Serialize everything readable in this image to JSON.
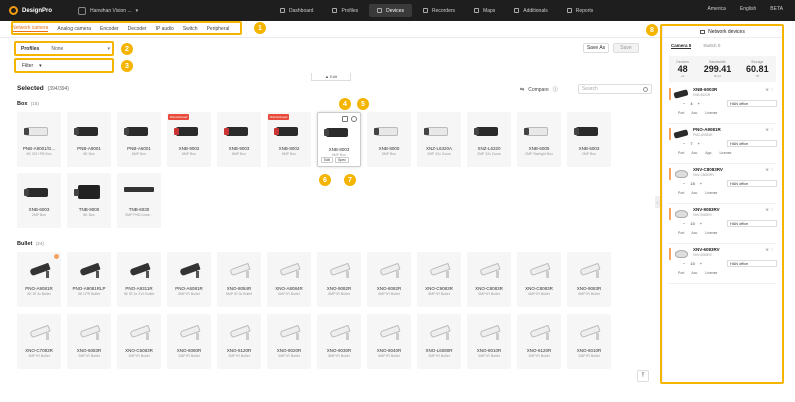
{
  "app": {
    "name": "DesignPro",
    "project": "Hanwhan Vision ..."
  },
  "nav": [
    {
      "label": "Dashboard",
      "active": false
    },
    {
      "label": "Profiles",
      "active": false
    },
    {
      "label": "Devices",
      "active": true
    },
    {
      "label": "Recorders",
      "active": false
    },
    {
      "label": "Maps",
      "active": false
    },
    {
      "label": "Additionals",
      "active": false
    },
    {
      "label": "Reports",
      "active": false
    }
  ],
  "top_right": {
    "region": "America",
    "language": "English",
    "user": "BETA"
  },
  "subtabs": [
    "Network camera",
    "Analog camera",
    "Encoder",
    "Decoder",
    "IP audio",
    "Switch",
    "Peripheral"
  ],
  "profile": {
    "label": "Profiles",
    "value": "None"
  },
  "buttons": {
    "save_as": "Save As",
    "save": "Save"
  },
  "filter": {
    "label": "Filter"
  },
  "edit_tab": "▲ Edit",
  "selected": {
    "label": "Selected",
    "count": "(394/394)"
  },
  "compare": {
    "label": "Compare"
  },
  "search": {
    "placeholder": "Search"
  },
  "sections": {
    "box": {
      "title": "Box",
      "count": "(15)"
    },
    "bullet": {
      "title": "Bullet",
      "count": "(24)"
    }
  },
  "box_cards": [
    {
      "model": "PNB-A9001/G...",
      "desc": "8K 3CH PB Box",
      "style": "white",
      "tag": ""
    },
    {
      "model": "PNB-A9001",
      "desc": "8K Box",
      "style": "",
      "tag": ""
    },
    {
      "model": "PNB-A6001",
      "desc": "6MP Box",
      "style": "",
      "tag": ""
    },
    {
      "model": "XNB-9002",
      "desc": "8MP Box",
      "style": "pink",
      "tag": "Discontinued"
    },
    {
      "model": "XNB-9003",
      "desc": "8MP Box",
      "style": "pink",
      "tag": ""
    },
    {
      "model": "XNB-8002",
      "desc": "6MP Box",
      "style": "pink",
      "tag": "Discontinued"
    },
    {
      "model": "XNB-8003",
      "desc": "6MP Box",
      "style": "",
      "tag": "",
      "highlight": true
    },
    {
      "model": "XNB-8000",
      "desc": "5MP Box",
      "style": "white",
      "tag": ""
    },
    {
      "model": "XNZ-L6320A",
      "desc": "2MP 32x Zoom",
      "style": "white",
      "tag": ""
    },
    {
      "model": "XNZ-L6320",
      "desc": "2MP 32x Zoom",
      "style": "",
      "tag": ""
    },
    {
      "model": "XNB-6005",
      "desc": "2MP Starlight Box",
      "style": "white",
      "tag": ""
    },
    {
      "model": "XNB-6003",
      "desc": "2MP Box",
      "style": "",
      "tag": ""
    }
  ],
  "box_cards_2": [
    {
      "model": "XNB-6003",
      "desc": "2MP Box",
      "style": "",
      "type": "box"
    },
    {
      "model": "TNB-9000",
      "desc": "8K Box",
      "style": "",
      "type": "tall"
    },
    {
      "model": "TNB-6030",
      "desc": "2MP FHD Lowe...",
      "style": "",
      "type": "rack"
    }
  ],
  "card_actions": {
    "edit": "Edit",
    "spec": "Spec"
  },
  "bullet_cards": [
    {
      "model": "PNO-A9081R",
      "desc": "8K IR 3x Bullet",
      "badge": true
    },
    {
      "model": "PNO-A9081RLP",
      "desc": "8K LPR Bullet"
    },
    {
      "model": "PNO-A9311R",
      "desc": "8K IR 3x 31X Bullet"
    },
    {
      "model": "PNO-A6081R",
      "desc": "6MP IR Bullet"
    },
    {
      "model": "XNO-8084R",
      "desc": "6MP IR 3x Bullet",
      "white": true
    },
    {
      "model": "XNO-A8084R",
      "desc": "6MP IR Bullet",
      "white": true
    },
    {
      "model": "XNO-9082R",
      "desc": "8MP IR Bullet",
      "white": true
    },
    {
      "model": "XNO-8082R",
      "desc": "6MP IR Bullet",
      "white": true
    },
    {
      "model": "XNO-C9083R",
      "desc": "8MP IR Bullet",
      "white": true
    },
    {
      "model": "XNO-C8083R",
      "desc": "6MP IR Bullet",
      "white": true
    },
    {
      "model": "XNO-C8083R",
      "desc": "6MP IR Bullet",
      "white": true
    },
    {
      "model": "XNO-9083R",
      "desc": "8MP IR Bullet",
      "white": true
    }
  ],
  "bullet_cards_2": [
    {
      "model": "XNO-C7083R",
      "desc": "4MP IR Bullet",
      "white": true
    },
    {
      "model": "XNO-6083R",
      "desc": "2MP IR Bullet",
      "white": true
    },
    {
      "model": "XNO-C6083R",
      "desc": "2MP IR Bullet",
      "white": true
    },
    {
      "model": "XNO-6080R",
      "desc": "2MP IR Bullet",
      "white": true
    },
    {
      "model": "XNO-6120R",
      "desc": "2MP IR Bullet",
      "white": true
    },
    {
      "model": "XNO-8020R",
      "desc": "6MP IR Bullet",
      "white": true
    },
    {
      "model": "XNO-9030R",
      "desc": "8MP IR Bullet",
      "white": true
    },
    {
      "model": "XNO-8040R",
      "desc": "6MP IR Bullet",
      "white": true
    },
    {
      "model": "XNO-L6080R",
      "desc": "2MP IR Bullet",
      "white": true
    },
    {
      "model": "XNO-8010R",
      "desc": "6MP IR Bullet",
      "white": true
    },
    {
      "model": "XNO-6120R",
      "desc": "2MP IR Bullet",
      "white": true
    },
    {
      "model": "XNO-6010R",
      "desc": "2MP IR Bullet",
      "white": true
    }
  ],
  "panel": {
    "title": "Network devices",
    "tabs": [
      {
        "label": "Camera",
        "count": "5",
        "active": true
      },
      {
        "label": "Switch",
        "count": "0",
        "active": false
      }
    ],
    "stats": [
      {
        "key": "Devices",
        "value": "48",
        "unit": "ea"
      },
      {
        "key": "Bandwidth",
        "value": "299.41",
        "unit": "Mbps"
      },
      {
        "key": "Storage",
        "value": "60.81",
        "unit": "TB"
      }
    ],
    "devices": [
      {
        "name": "XNB-6003R",
        "sub": "XNB-6003R",
        "qty": "4",
        "net": "HAN office",
        "links": [
          "Port",
          "Acc.",
          "License"
        ],
        "thumb": "bullet"
      },
      {
        "name": "PNO-A9081R",
        "sub": "PNO-A9081R",
        "qty": "7",
        "net": "HAN office",
        "links": [
          "Port",
          "Acc.",
          "App.",
          "License"
        ],
        "thumb": "bullet"
      },
      {
        "name": "XNV-C8083RV",
        "sub": "XNV-C8083RV",
        "qty": "15",
        "net": "HAN office",
        "links": [
          "Port",
          "Acc.",
          "License"
        ],
        "thumb": "dome"
      },
      {
        "name": "XNV-9083RV",
        "sub": "XNV-9083RV",
        "qty": "10",
        "net": "HAN office",
        "links": [
          "Port",
          "Acc.",
          "License"
        ],
        "thumb": "dome"
      },
      {
        "name": "XNV-6083RV",
        "sub": "XNV-6083RV",
        "qty": "10",
        "net": "HAN office",
        "links": [
          "Port",
          "Acc.",
          "License"
        ],
        "thumb": "dome"
      }
    ]
  },
  "callouts": [
    "1",
    "2",
    "3",
    "4",
    "5",
    "6",
    "7",
    "8"
  ],
  "colors": {
    "accent": "#e8731c",
    "highlight": "#f4b400",
    "topbar": "#1e1e1e"
  }
}
